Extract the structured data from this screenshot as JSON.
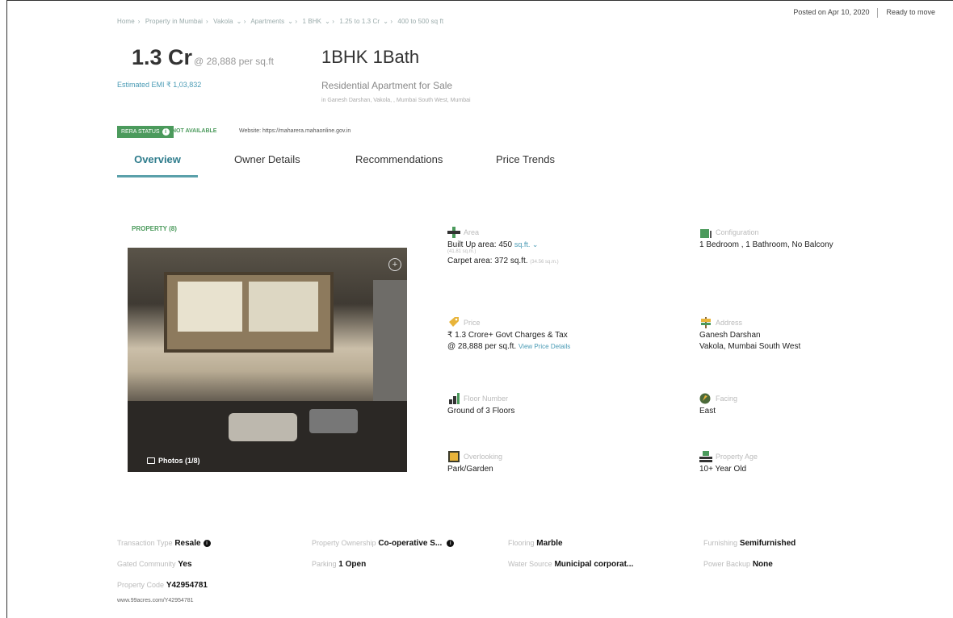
{
  "breadcrumb": [
    "Home",
    "Property in Mumbai",
    "Vakola",
    "Apartments",
    "1 BHK",
    "1.25 to 1.3 Cr",
    "400 to 500 sq ft"
  ],
  "posted": {
    "date": "Posted on Apr 10, 2020",
    "status": "Ready to move"
  },
  "price": {
    "amount": "1.3 Cr",
    "per": "@ 28,888 per sq.ft",
    "emi": "Estimated EMI ₹ 1,03,832"
  },
  "listing": {
    "title": "1BHK 1Bath",
    "subtitle": "Residential Apartment for Sale",
    "location": "in Ganesh Darshan, Vakola, , Mumbai South West, Mumbai"
  },
  "rera": {
    "badge": "RERA STATUS",
    "status": "NOT AVAILABLE",
    "website": "Website: https://maharera.mahaonline.gov.in"
  },
  "tabs": [
    "Overview",
    "Owner Details",
    "Recommendations",
    "Price Trends"
  ],
  "property_label": "PROPERTY (8)",
  "photos_label": "Photos (1/8)",
  "details": {
    "area": {
      "label": "Area",
      "built": "Built Up area: 450",
      "unit": "sq.ft. ⌄",
      "built_sqm": "(41.81 sq.m.)",
      "carpet": "Carpet area: 372 sq.ft.",
      "carpet_sqm": "(34.56 sq.m.)"
    },
    "configuration": {
      "label": "Configuration",
      "value": "1 Bedroom , 1 Bathroom, No Balcony"
    },
    "price": {
      "label": "Price",
      "value": "₹ 1.3 Crore+ Govt Charges & Tax",
      "per": "@ 28,888 per sq.ft.",
      "link": "View Price Details"
    },
    "address": {
      "label": "Address",
      "line1": "Ganesh Darshan",
      "line2": "Vakola, Mumbai South West"
    },
    "floor": {
      "label": "Floor Number",
      "value": "Ground of 3 Floors"
    },
    "facing": {
      "label": "Facing",
      "value": "East"
    },
    "overlooking": {
      "label": "Overlooking",
      "value": "Park/Garden"
    },
    "age": {
      "label": "Property Age",
      "value": "10+ Year Old"
    }
  },
  "footer": {
    "transaction": {
      "k": "Transaction Type",
      "v": "Resale"
    },
    "ownership": {
      "k": "Property Ownership",
      "v": "Co-operative S..."
    },
    "flooring": {
      "k": "Flooring",
      "v": "Marble"
    },
    "furnishing": {
      "k": "Furnishing",
      "v": "Semifurnished"
    },
    "gated": {
      "k": "Gated Community",
      "v": "Yes"
    },
    "parking": {
      "k": "Parking",
      "v": "1 Open"
    },
    "water": {
      "k": "Water Source",
      "v": "Municipal corporat..."
    },
    "power": {
      "k": "Power Backup",
      "v": "None"
    },
    "code": {
      "k": "Property Code",
      "v": "Y42954781"
    },
    "url": "www.99acres.com/Y42954781"
  },
  "colors": {
    "accent": "#4b9a5c",
    "link": "#4a9bb5",
    "tab_active": "#2e7c8c"
  }
}
